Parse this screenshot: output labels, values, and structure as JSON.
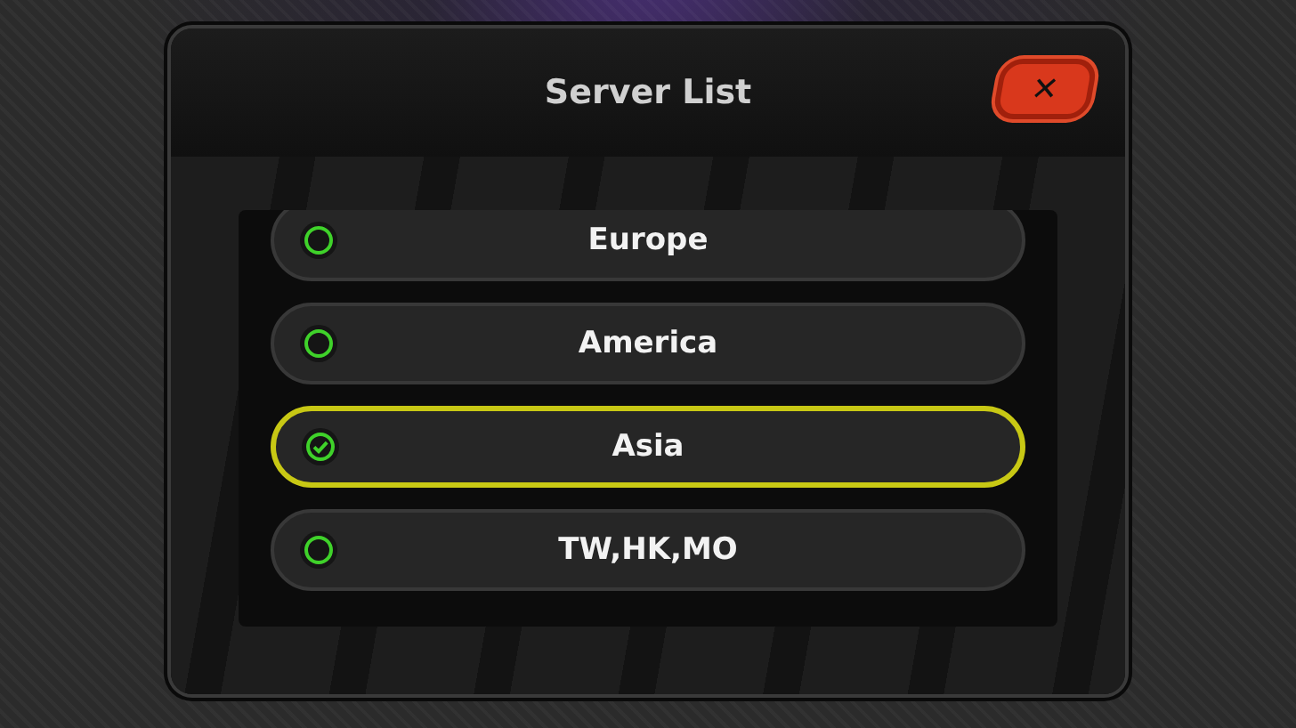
{
  "dialog": {
    "title": "Server List",
    "close_label": "✕"
  },
  "servers": [
    {
      "name": "Europe",
      "selected": false
    },
    {
      "name": "America",
      "selected": false
    },
    {
      "name": "Asia",
      "selected": true
    },
    {
      "name": "TW,HK,MO",
      "selected": false
    }
  ]
}
